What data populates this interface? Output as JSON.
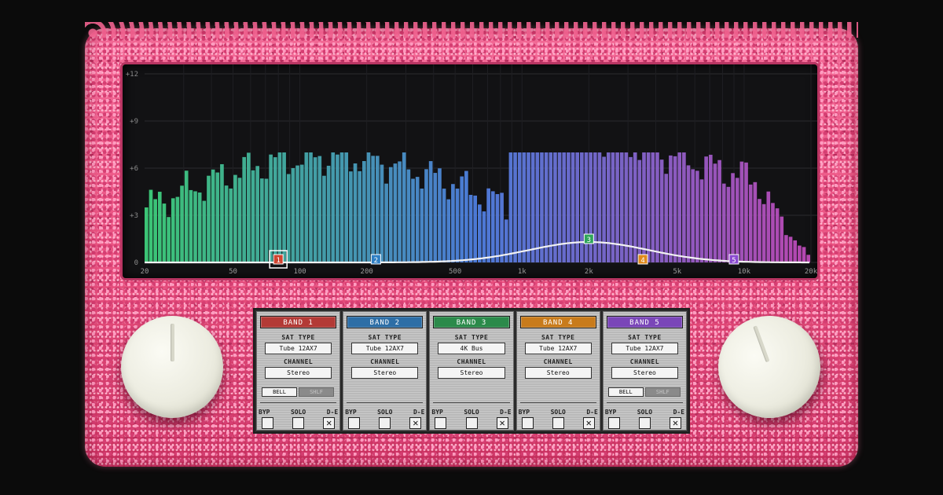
{
  "eq_display": {
    "db_ticks": [
      "+12",
      "+9",
      "+6",
      "+3",
      "0"
    ],
    "freq_ticks": [
      "20",
      "50",
      "100",
      "200",
      "500",
      "1k",
      "2k",
      "5k",
      "10k",
      "20k"
    ],
    "colors": {
      "spectrum_low": "#3ecf7a",
      "spectrum_mid": "#4f7fe0",
      "spectrum_high": "#c04ab8"
    },
    "band_nodes": [
      {
        "label": "1",
        "freq": 80,
        "gain_db": 0,
        "color": "#d0432f",
        "selected": true
      },
      {
        "label": "2",
        "freq": 220,
        "gain_db": 0,
        "color": "#2f7fc4"
      },
      {
        "label": "3",
        "freq": 2000,
        "gain_db": 1.3,
        "color": "#2fa55a"
      },
      {
        "label": "4",
        "freq": 3500,
        "gain_db": 0,
        "color": "#e08a1c"
      },
      {
        "label": "5",
        "freq": 9000,
        "gain_db": 0,
        "color": "#8a4ad0"
      }
    ]
  },
  "bands": [
    {
      "title": "BAND 1",
      "color": "#b33a36",
      "sat_type_label": "SAT TYPE",
      "sat_type": "Tube 12AX7",
      "channel_label": "CHANNEL",
      "channel": "Stereo",
      "shape": {
        "a": "BELL",
        "b": "SHLF",
        "a_on": true
      },
      "toggle_labels": [
        "BYP",
        "SOLO",
        "D-E"
      ],
      "toggles": [
        false,
        false,
        true
      ]
    },
    {
      "title": "BAND 2",
      "color": "#2d6ea6",
      "sat_type_label": "SAT TYPE",
      "sat_type": "Tube 12AX7",
      "channel_label": "CHANNEL",
      "channel": "Stereo",
      "toggle_labels": [
        "BYP",
        "SOLO",
        "D-E"
      ],
      "toggles": [
        false,
        false,
        true
      ]
    },
    {
      "title": "BAND 3",
      "color": "#2b8a4a",
      "sat_type_label": "SAT TYPE",
      "sat_type": "4K Bus",
      "channel_label": "CHANNEL",
      "channel": "Stereo",
      "toggle_labels": [
        "BYP",
        "SOLO",
        "D-E"
      ],
      "toggles": [
        false,
        false,
        true
      ]
    },
    {
      "title": "BAND 4",
      "color": "#c87b1b",
      "sat_type_label": "SAT TYPE",
      "sat_type": "Tube 12AX7",
      "channel_label": "CHANNEL",
      "channel": "Stereo",
      "toggle_labels": [
        "BYP",
        "SOLO",
        "D-E"
      ],
      "toggles": [
        false,
        false,
        true
      ]
    },
    {
      "title": "BAND 5",
      "color": "#7a46b8",
      "sat_type_label": "SAT TYPE",
      "sat_type": "Tube 12AX7",
      "channel_label": "CHANNEL",
      "channel": "Stereo",
      "shape": {
        "a": "BELL",
        "b": "SHLF",
        "a_on": true
      },
      "toggle_labels": [
        "BYP",
        "SOLO",
        "D-E"
      ],
      "toggles": [
        false,
        false,
        true
      ]
    }
  ],
  "knobs": {
    "left": "knob",
    "right": "knob"
  }
}
